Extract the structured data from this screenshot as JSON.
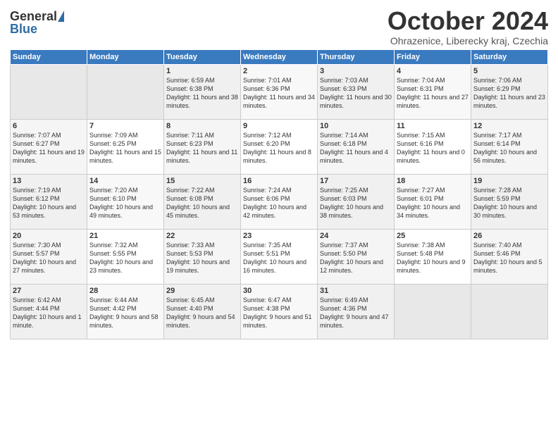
{
  "header": {
    "logo_general": "General",
    "logo_blue": "Blue",
    "title": "October 2024",
    "location": "Ohrazenice, Liberecky kraj, Czechia"
  },
  "weekdays": [
    "Sunday",
    "Monday",
    "Tuesday",
    "Wednesday",
    "Thursday",
    "Friday",
    "Saturday"
  ],
  "weeks": [
    [
      {
        "num": "",
        "info": ""
      },
      {
        "num": "",
        "info": ""
      },
      {
        "num": "1",
        "info": "Sunrise: 6:59 AM\nSunset: 6:38 PM\nDaylight: 11 hours and 38 minutes."
      },
      {
        "num": "2",
        "info": "Sunrise: 7:01 AM\nSunset: 6:36 PM\nDaylight: 11 hours and 34 minutes."
      },
      {
        "num": "3",
        "info": "Sunrise: 7:03 AM\nSunset: 6:33 PM\nDaylight: 11 hours and 30 minutes."
      },
      {
        "num": "4",
        "info": "Sunrise: 7:04 AM\nSunset: 6:31 PM\nDaylight: 11 hours and 27 minutes."
      },
      {
        "num": "5",
        "info": "Sunrise: 7:06 AM\nSunset: 6:29 PM\nDaylight: 11 hours and 23 minutes."
      }
    ],
    [
      {
        "num": "6",
        "info": "Sunrise: 7:07 AM\nSunset: 6:27 PM\nDaylight: 11 hours and 19 minutes."
      },
      {
        "num": "7",
        "info": "Sunrise: 7:09 AM\nSunset: 6:25 PM\nDaylight: 11 hours and 15 minutes."
      },
      {
        "num": "8",
        "info": "Sunrise: 7:11 AM\nSunset: 6:23 PM\nDaylight: 11 hours and 11 minutes."
      },
      {
        "num": "9",
        "info": "Sunrise: 7:12 AM\nSunset: 6:20 PM\nDaylight: 11 hours and 8 minutes."
      },
      {
        "num": "10",
        "info": "Sunrise: 7:14 AM\nSunset: 6:18 PM\nDaylight: 11 hours and 4 minutes."
      },
      {
        "num": "11",
        "info": "Sunrise: 7:15 AM\nSunset: 6:16 PM\nDaylight: 11 hours and 0 minutes."
      },
      {
        "num": "12",
        "info": "Sunrise: 7:17 AM\nSunset: 6:14 PM\nDaylight: 10 hours and 56 minutes."
      }
    ],
    [
      {
        "num": "13",
        "info": "Sunrise: 7:19 AM\nSunset: 6:12 PM\nDaylight: 10 hours and 53 minutes."
      },
      {
        "num": "14",
        "info": "Sunrise: 7:20 AM\nSunset: 6:10 PM\nDaylight: 10 hours and 49 minutes."
      },
      {
        "num": "15",
        "info": "Sunrise: 7:22 AM\nSunset: 6:08 PM\nDaylight: 10 hours and 45 minutes."
      },
      {
        "num": "16",
        "info": "Sunrise: 7:24 AM\nSunset: 6:06 PM\nDaylight: 10 hours and 42 minutes."
      },
      {
        "num": "17",
        "info": "Sunrise: 7:25 AM\nSunset: 6:03 PM\nDaylight: 10 hours and 38 minutes."
      },
      {
        "num": "18",
        "info": "Sunrise: 7:27 AM\nSunset: 6:01 PM\nDaylight: 10 hours and 34 minutes."
      },
      {
        "num": "19",
        "info": "Sunrise: 7:28 AM\nSunset: 5:59 PM\nDaylight: 10 hours and 30 minutes."
      }
    ],
    [
      {
        "num": "20",
        "info": "Sunrise: 7:30 AM\nSunset: 5:57 PM\nDaylight: 10 hours and 27 minutes."
      },
      {
        "num": "21",
        "info": "Sunrise: 7:32 AM\nSunset: 5:55 PM\nDaylight: 10 hours and 23 minutes."
      },
      {
        "num": "22",
        "info": "Sunrise: 7:33 AM\nSunset: 5:53 PM\nDaylight: 10 hours and 19 minutes."
      },
      {
        "num": "23",
        "info": "Sunrise: 7:35 AM\nSunset: 5:51 PM\nDaylight: 10 hours and 16 minutes."
      },
      {
        "num": "24",
        "info": "Sunrise: 7:37 AM\nSunset: 5:50 PM\nDaylight: 10 hours and 12 minutes."
      },
      {
        "num": "25",
        "info": "Sunrise: 7:38 AM\nSunset: 5:48 PM\nDaylight: 10 hours and 9 minutes."
      },
      {
        "num": "26",
        "info": "Sunrise: 7:40 AM\nSunset: 5:46 PM\nDaylight: 10 hours and 5 minutes."
      }
    ],
    [
      {
        "num": "27",
        "info": "Sunrise: 6:42 AM\nSunset: 4:44 PM\nDaylight: 10 hours and 1 minute."
      },
      {
        "num": "28",
        "info": "Sunrise: 6:44 AM\nSunset: 4:42 PM\nDaylight: 9 hours and 58 minutes."
      },
      {
        "num": "29",
        "info": "Sunrise: 6:45 AM\nSunset: 4:40 PM\nDaylight: 9 hours and 54 minutes."
      },
      {
        "num": "30",
        "info": "Sunrise: 6:47 AM\nSunset: 4:38 PM\nDaylight: 9 hours and 51 minutes."
      },
      {
        "num": "31",
        "info": "Sunrise: 6:49 AM\nSunset: 4:36 PM\nDaylight: 9 hours and 47 minutes."
      },
      {
        "num": "",
        "info": ""
      },
      {
        "num": "",
        "info": ""
      }
    ]
  ]
}
